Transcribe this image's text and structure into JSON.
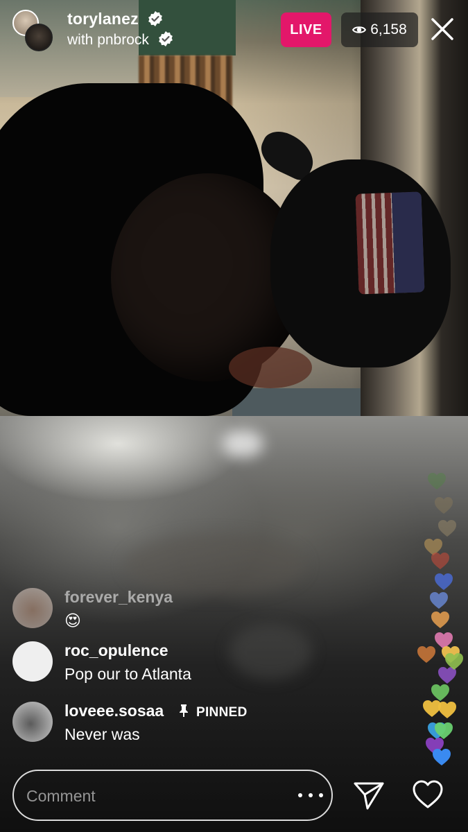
{
  "header": {
    "host_username": "torylanez",
    "guest_prefix": "with",
    "guest_username": "pnbrock",
    "live_label": "LIVE",
    "viewer_count": "6,158"
  },
  "comments": [
    {
      "username": "forever_kenya",
      "text": "😍",
      "dimmed": true
    },
    {
      "username": "roc_opulence",
      "text": "Pop our to Atlanta"
    },
    {
      "username": "loveee.sosaa",
      "text": "Never was",
      "pinned_label": "PINNED"
    }
  ],
  "composer": {
    "placeholder": "Comment"
  },
  "icons": {
    "verified": "verified-badge-icon",
    "eye": "eye-icon",
    "close": "close-icon",
    "pin": "pin-icon",
    "more": "more-dots-icon",
    "send": "send-icon",
    "like": "heart-icon"
  },
  "colors": {
    "live_badge": "#e3176a",
    "verified": "#3897f0"
  }
}
